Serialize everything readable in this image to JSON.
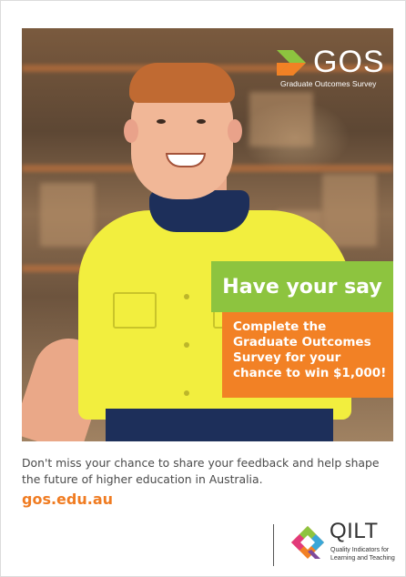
{
  "logo": {
    "name": "GOS",
    "subtitle": "Graduate Outcomes Survey"
  },
  "headline": "Have your say",
  "promo_lines": [
    "Complete the",
    "Graduate Outcomes",
    "Survey for your",
    "chance to win $1,000!"
  ],
  "tagline": "Don't miss your chance to share your feedback and help shape the future of higher education in Australia.",
  "url": "gos.edu.au",
  "footer_logo": {
    "name": "QILT",
    "subtitle_lines": [
      "Quality Indicators for",
      "Learning and Teaching"
    ]
  },
  "colors": {
    "green": "#8dc43f",
    "orange": "#f28125",
    "url_orange": "#f07c22"
  },
  "icons": [
    "gos-chevron-icon",
    "qilt-q-icon"
  ]
}
